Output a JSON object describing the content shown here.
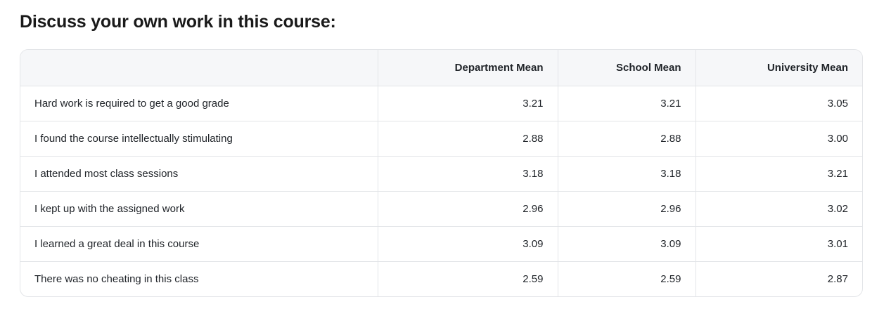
{
  "section": {
    "title": "Discuss your own work in this course:"
  },
  "table": {
    "headers": {
      "label": "",
      "department_mean": "Department Mean",
      "school_mean": "School Mean",
      "university_mean": "University Mean"
    },
    "rows": [
      {
        "label": "Hard work is required to get a good grade",
        "department_mean": "3.21",
        "school_mean": "3.21",
        "university_mean": "3.05"
      },
      {
        "label": "I found the course intellectually stimulating",
        "department_mean": "2.88",
        "school_mean": "2.88",
        "university_mean": "3.00"
      },
      {
        "label": "I attended most class sessions",
        "department_mean": "3.18",
        "school_mean": "3.18",
        "university_mean": "3.21"
      },
      {
        "label": "I kept up with the assigned work",
        "department_mean": "2.96",
        "school_mean": "2.96",
        "university_mean": "3.02"
      },
      {
        "label": "I learned a great deal in this course",
        "department_mean": "3.09",
        "school_mean": "3.09",
        "university_mean": "3.01"
      },
      {
        "label": "There was no cheating in this class",
        "department_mean": "2.59",
        "school_mean": "2.59",
        "university_mean": "2.87"
      }
    ]
  }
}
